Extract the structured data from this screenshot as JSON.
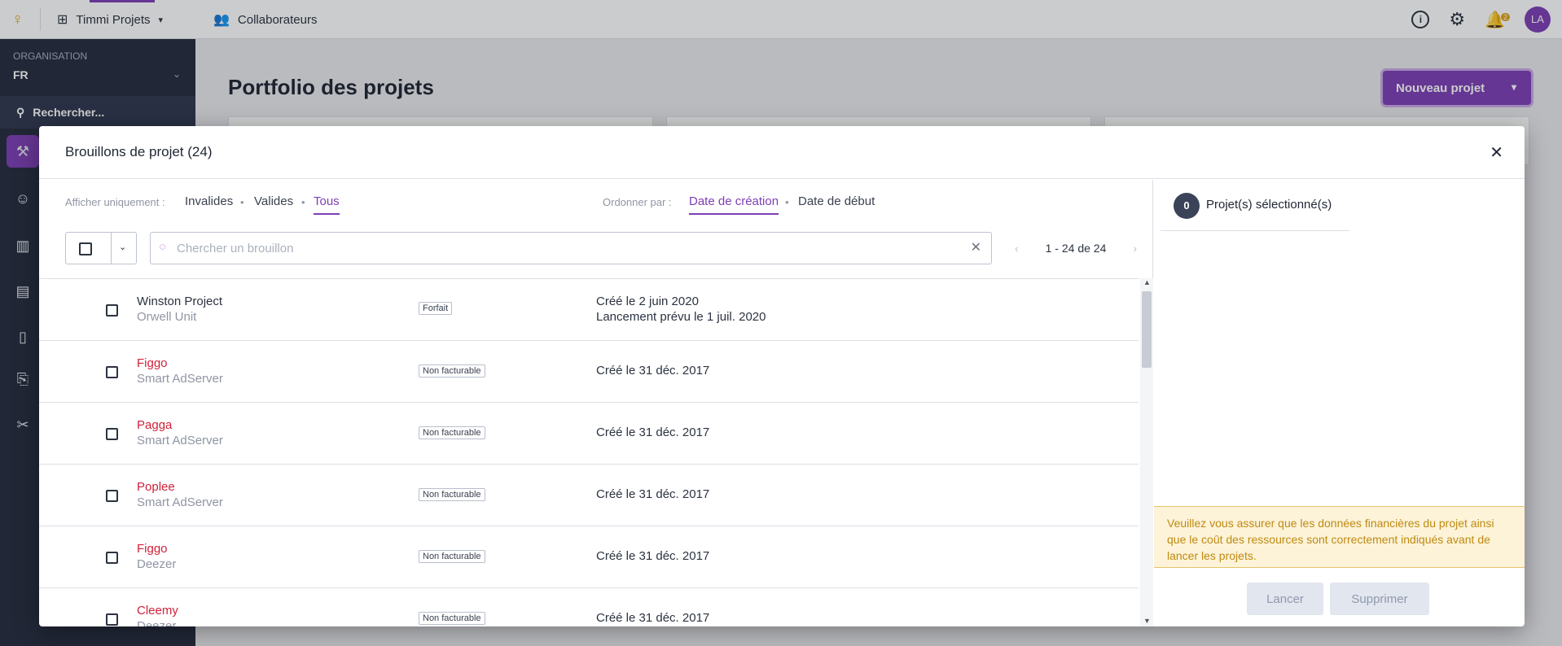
{
  "topbar": {
    "app_name": "Timmi Projets",
    "collaborators": "Collaborateurs",
    "notifications_count": "2",
    "avatar_initials": "LA"
  },
  "sidebar": {
    "org_label": "ORGANISATION",
    "org_value": "FR",
    "search_label": "Rechercher..."
  },
  "page": {
    "title": "Portfolio des projets",
    "new_project_button": "Nouveau projet"
  },
  "modal": {
    "title": "Brouillons de projet (24)",
    "filter_label": "Afficher uniquement :",
    "filters": [
      "Invalides",
      "Valides",
      "Tous"
    ],
    "active_filter": "Tous",
    "order_label": "Ordonner par :",
    "orders": [
      "Date de création",
      "Date de début"
    ],
    "active_order": "Date de création",
    "search_placeholder": "Chercher un brouillon",
    "pagination": "1 - 24 de 24",
    "rows": [
      {
        "name": "Winston Project",
        "client": "Orwell Unit",
        "tag": "Forfait",
        "created": "Créé le 2 juin 2020",
        "launch": "Lancement prévu le 1 juil. 2020",
        "invalid": false
      },
      {
        "name": "Figgo",
        "client": "Smart AdServer",
        "tag": "Non facturable",
        "created": "Créé le 31 déc. 2017",
        "launch": "",
        "invalid": true
      },
      {
        "name": "Pagga",
        "client": "Smart AdServer",
        "tag": "Non facturable",
        "created": "Créé le 31 déc. 2017",
        "launch": "",
        "invalid": true
      },
      {
        "name": "Poplee",
        "client": "Smart AdServer",
        "tag": "Non facturable",
        "created": "Créé le 31 déc. 2017",
        "launch": "",
        "invalid": true
      },
      {
        "name": "Figgo",
        "client": "Deezer",
        "tag": "Non facturable",
        "created": "Créé le 31 déc. 2017",
        "launch": "",
        "invalid": true
      },
      {
        "name": "Cleemy",
        "client": "Deezer",
        "tag": "Non facturable",
        "created": "Créé le 31 déc. 2017",
        "launch": "",
        "invalid": true
      }
    ],
    "selected_count": "0",
    "selected_label": "Projet(s) sélectionné(s)",
    "warning": "Veuillez vous assurer que les données financières du projet ainsi que le coût des ressources sont correctement indiqués avant de lancer les projets.",
    "launch_button": "Lancer",
    "delete_button": "Supprimer"
  },
  "colors": {
    "accent": "#7d3fb5",
    "invalid_name": "#d0213a",
    "sidebar_bg": "#262c3e",
    "warning_bg": "#fcf3d9",
    "warning_text": "#c08a10"
  }
}
